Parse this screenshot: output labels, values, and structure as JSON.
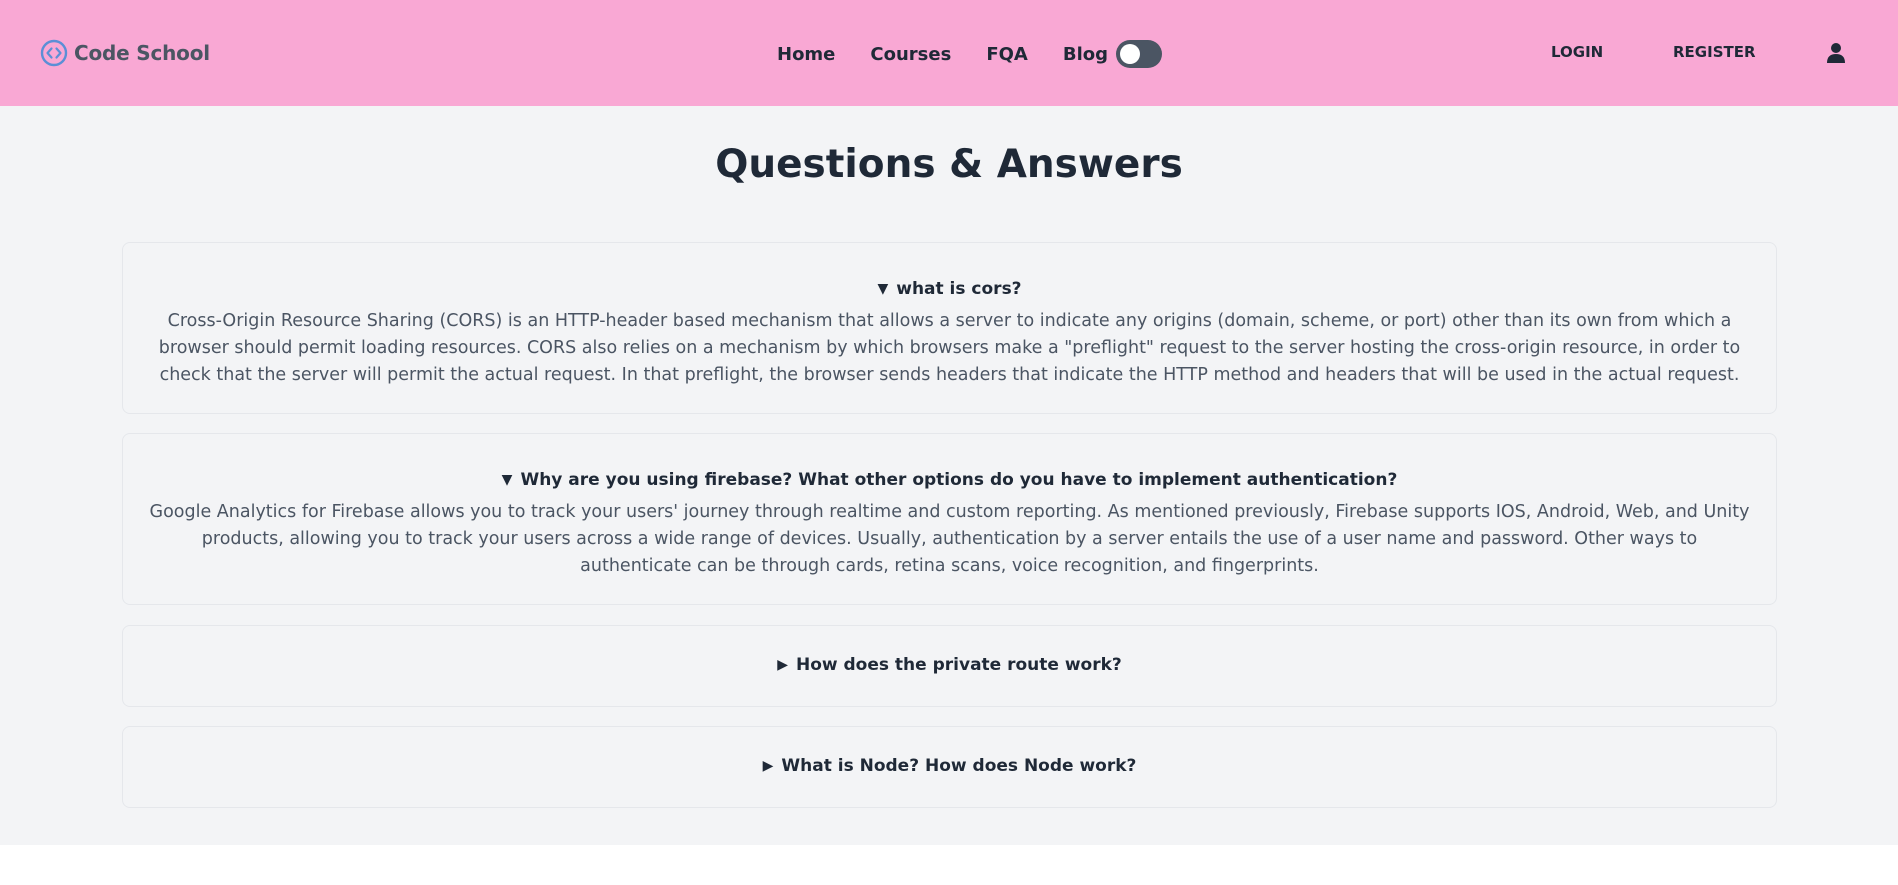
{
  "brand": {
    "name": "Code School"
  },
  "nav": {
    "home": "Home",
    "courses": "Courses",
    "fqa": "FQA",
    "blog": "Blog"
  },
  "theme_toggle": {
    "state": "off"
  },
  "auth": {
    "login": "LOGIN",
    "register": "REGISTER"
  },
  "page": {
    "title": "Questions & Answers"
  },
  "faq": [
    {
      "arrow": "▼",
      "question": "what is cors?",
      "answer": "Cross-Origin Resource Sharing (CORS) is an HTTP-header based mechanism that allows a server to indicate any origins (domain, scheme, or port) other than its own from which a browser should permit loading resources. CORS also relies on a mechanism by which browsers make a \"preflight\" request to the server hosting the cross-origin resource, in order to check that the server will permit the actual request. In that preflight, the browser sends headers that indicate the HTTP method and headers that will be used in the actual request."
    },
    {
      "arrow": "▼",
      "question": "Why are you using firebase? What other options do you have to implement authentication?",
      "answer": "Google Analytics for Firebase allows you to track your users' journey through realtime and custom reporting. As mentioned previously, Firebase supports IOS, Android, Web, and Unity products, allowing you to track your users across a wide range of devices. Usually, authentication by a server entails the use of a user name and password. Other ways to authenticate can be through cards, retina scans, voice recognition, and fingerprints."
    },
    {
      "arrow": "▶",
      "question": "How does the private route work?"
    },
    {
      "arrow": "▶",
      "question": "What is Node? How does Node work?"
    }
  ],
  "colors": {
    "navbar_bg": "#f9a8d4",
    "page_bg": "#f3f4f6",
    "brand_text": "#4b5563",
    "brand_icon": "#5b8fd6",
    "toggle_bg": "#4b5563"
  },
  "icons": {
    "brand": "code-brackets-circle-icon",
    "user": "user-icon"
  }
}
